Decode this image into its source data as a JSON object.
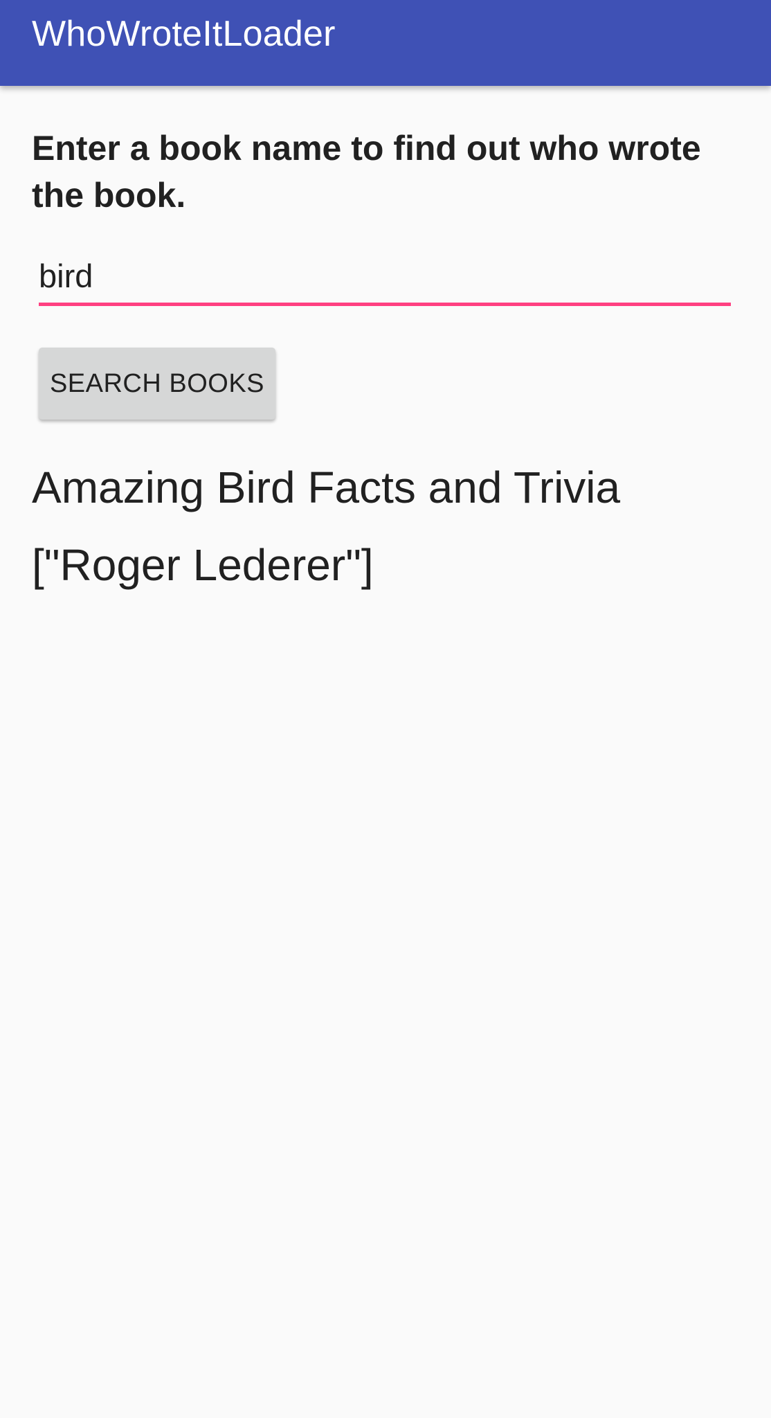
{
  "app_bar": {
    "title": "WhoWroteItLoader"
  },
  "main": {
    "instructions": "Enter a book name to find out who wrote the book.",
    "search_input": {
      "value": "bird",
      "placeholder": ""
    },
    "search_button_label": "Search Books",
    "result": {
      "title": "Amazing Bird Facts and Trivia",
      "authors": "[\"Roger Lederer\"]"
    }
  },
  "colors": {
    "app_bar": "#3f51b5",
    "accent": "#ff4081",
    "background": "#fafafa",
    "button": "#d6d7d7"
  }
}
